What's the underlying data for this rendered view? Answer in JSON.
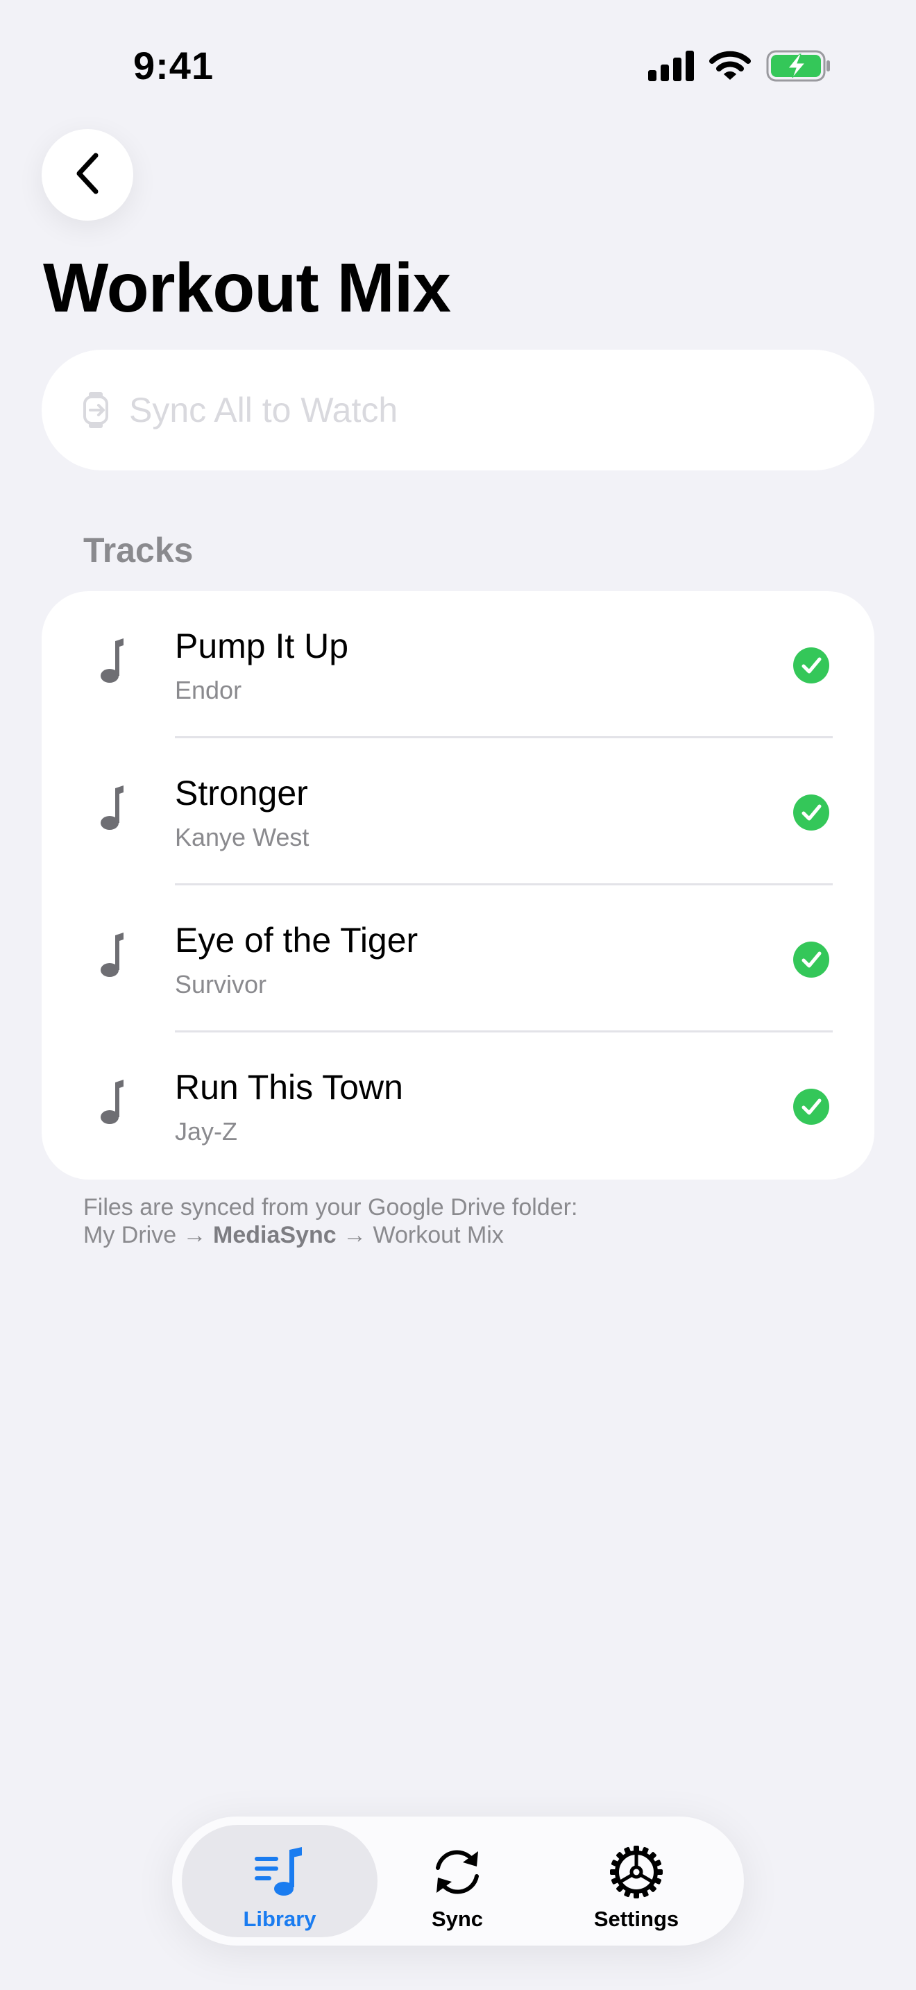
{
  "status_bar": {
    "time": "9:41"
  },
  "header": {
    "title": "Workout Mix"
  },
  "sync_all": {
    "label": "Sync All to Watch",
    "enabled": false
  },
  "tracks_section": {
    "header": "Tracks",
    "items": [
      {
        "title": "Pump It Up",
        "artist": "Endor",
        "synced": true
      },
      {
        "title": "Stronger",
        "artist": "Kanye West",
        "synced": true
      },
      {
        "title": "Eye of the Tiger",
        "artist": "Survivor",
        "synced": true
      },
      {
        "title": "Run This Town",
        "artist": "Jay-Z",
        "synced": true
      }
    ]
  },
  "footer": {
    "line1": "Files are synced from your Google Drive folder:",
    "path_prefix": "My Drive →",
    "path_bold": "MediaSync",
    "path_suffix": "→ Workout Mix"
  },
  "tab_bar": {
    "tabs": [
      {
        "label": "Library",
        "icon": "music-library-icon",
        "active": true
      },
      {
        "label": "Sync",
        "icon": "sync-arrows-icon",
        "active": false
      },
      {
        "label": "Settings",
        "icon": "gear-icon",
        "active": false
      }
    ]
  },
  "colors": {
    "background": "#f2f2f7",
    "accent": "#1a7cf0",
    "success": "#34c759",
    "secondary_text": "#8a8a8e"
  }
}
